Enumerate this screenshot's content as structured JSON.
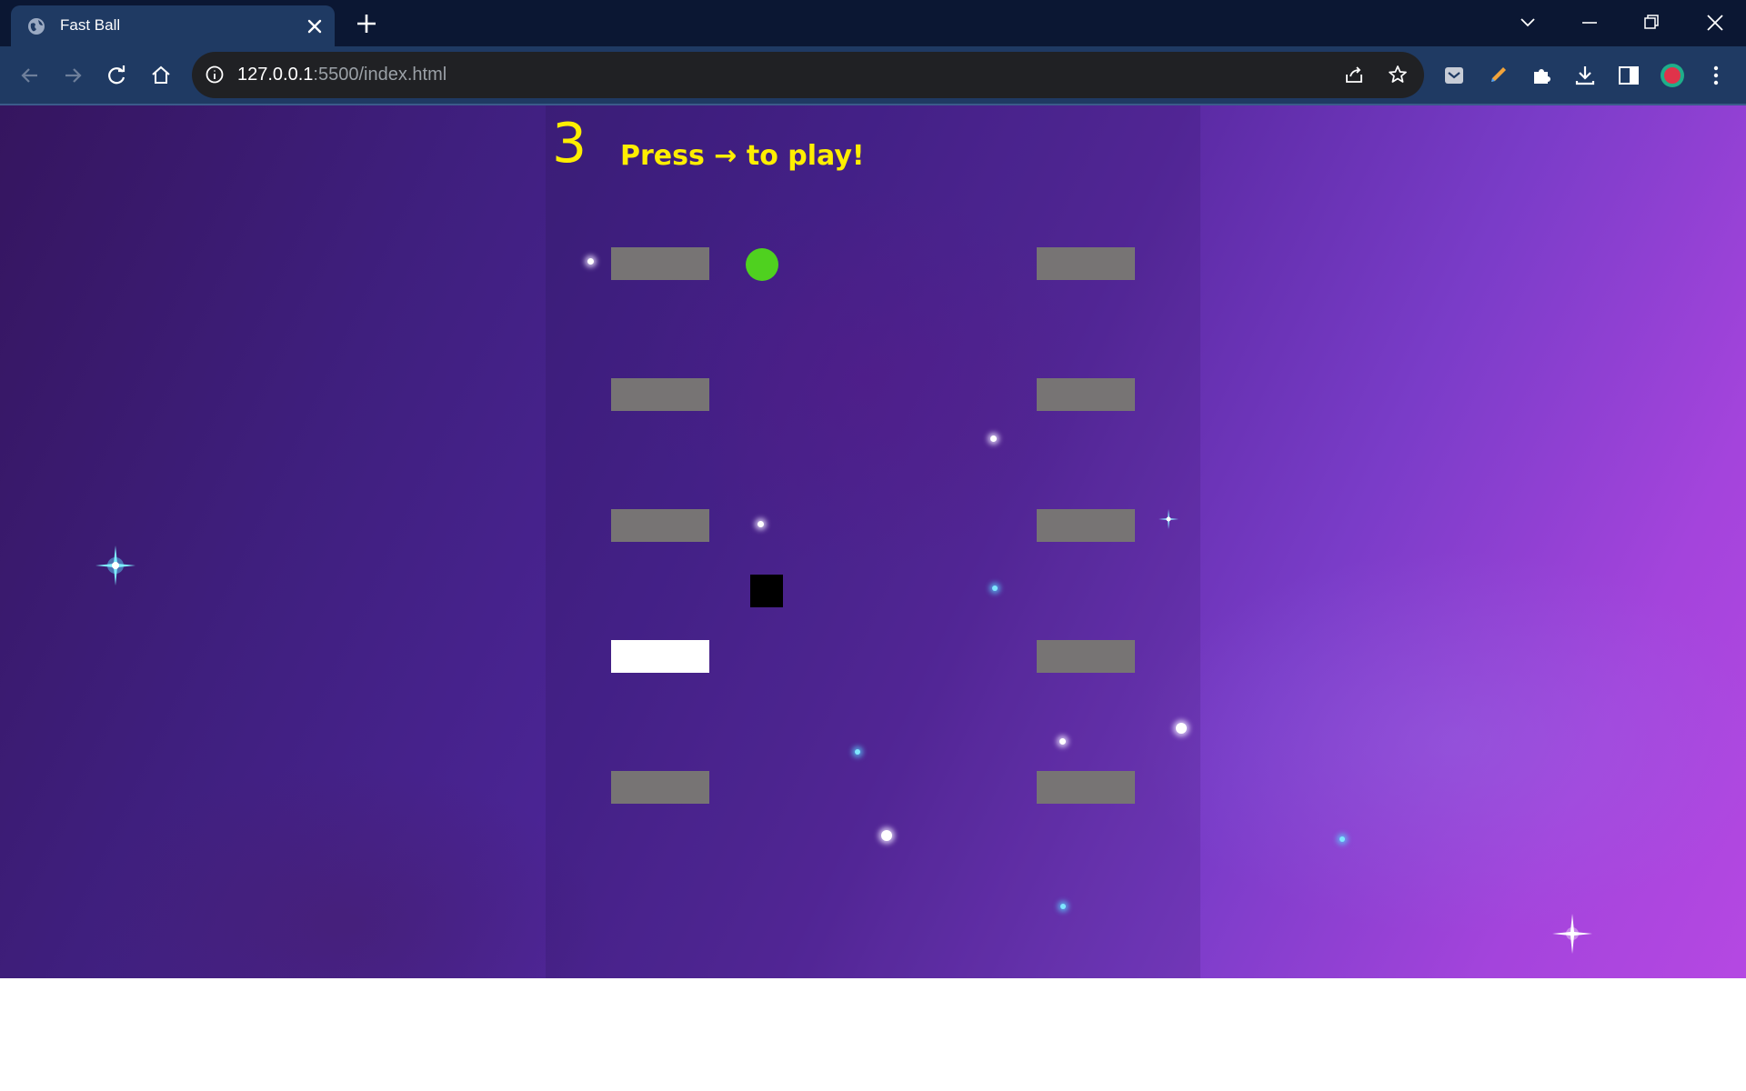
{
  "browser": {
    "tab_title": "Fast Ball",
    "url_host": "127.0.0.1",
    "url_rest": ":5500/index.html",
    "icons": [
      "globe-icon",
      "close-icon",
      "plus-icon",
      "chevron-down-icon",
      "minimize-icon",
      "restore-icon",
      "window-close-icon",
      "back-icon",
      "forward-icon",
      "reload-icon",
      "home-icon",
      "info-icon",
      "share-icon",
      "star-icon",
      "pocket-icon",
      "pen-icon",
      "puzzle-icon",
      "download-icon",
      "sidepanel-icon",
      "profile-avatar",
      "kebab-menu-icon"
    ]
  },
  "game": {
    "score": "3",
    "prompt": "Press → to play!",
    "colors": {
      "text": "#ffee00",
      "brick": "#777474",
      "brick_active": "#ffffff",
      "ball": "#4fd11f",
      "player": "#000000"
    },
    "bricks_left": {
      "rows": 5,
      "active_row_index": 3
    },
    "bricks_right": {
      "rows": 5
    }
  }
}
